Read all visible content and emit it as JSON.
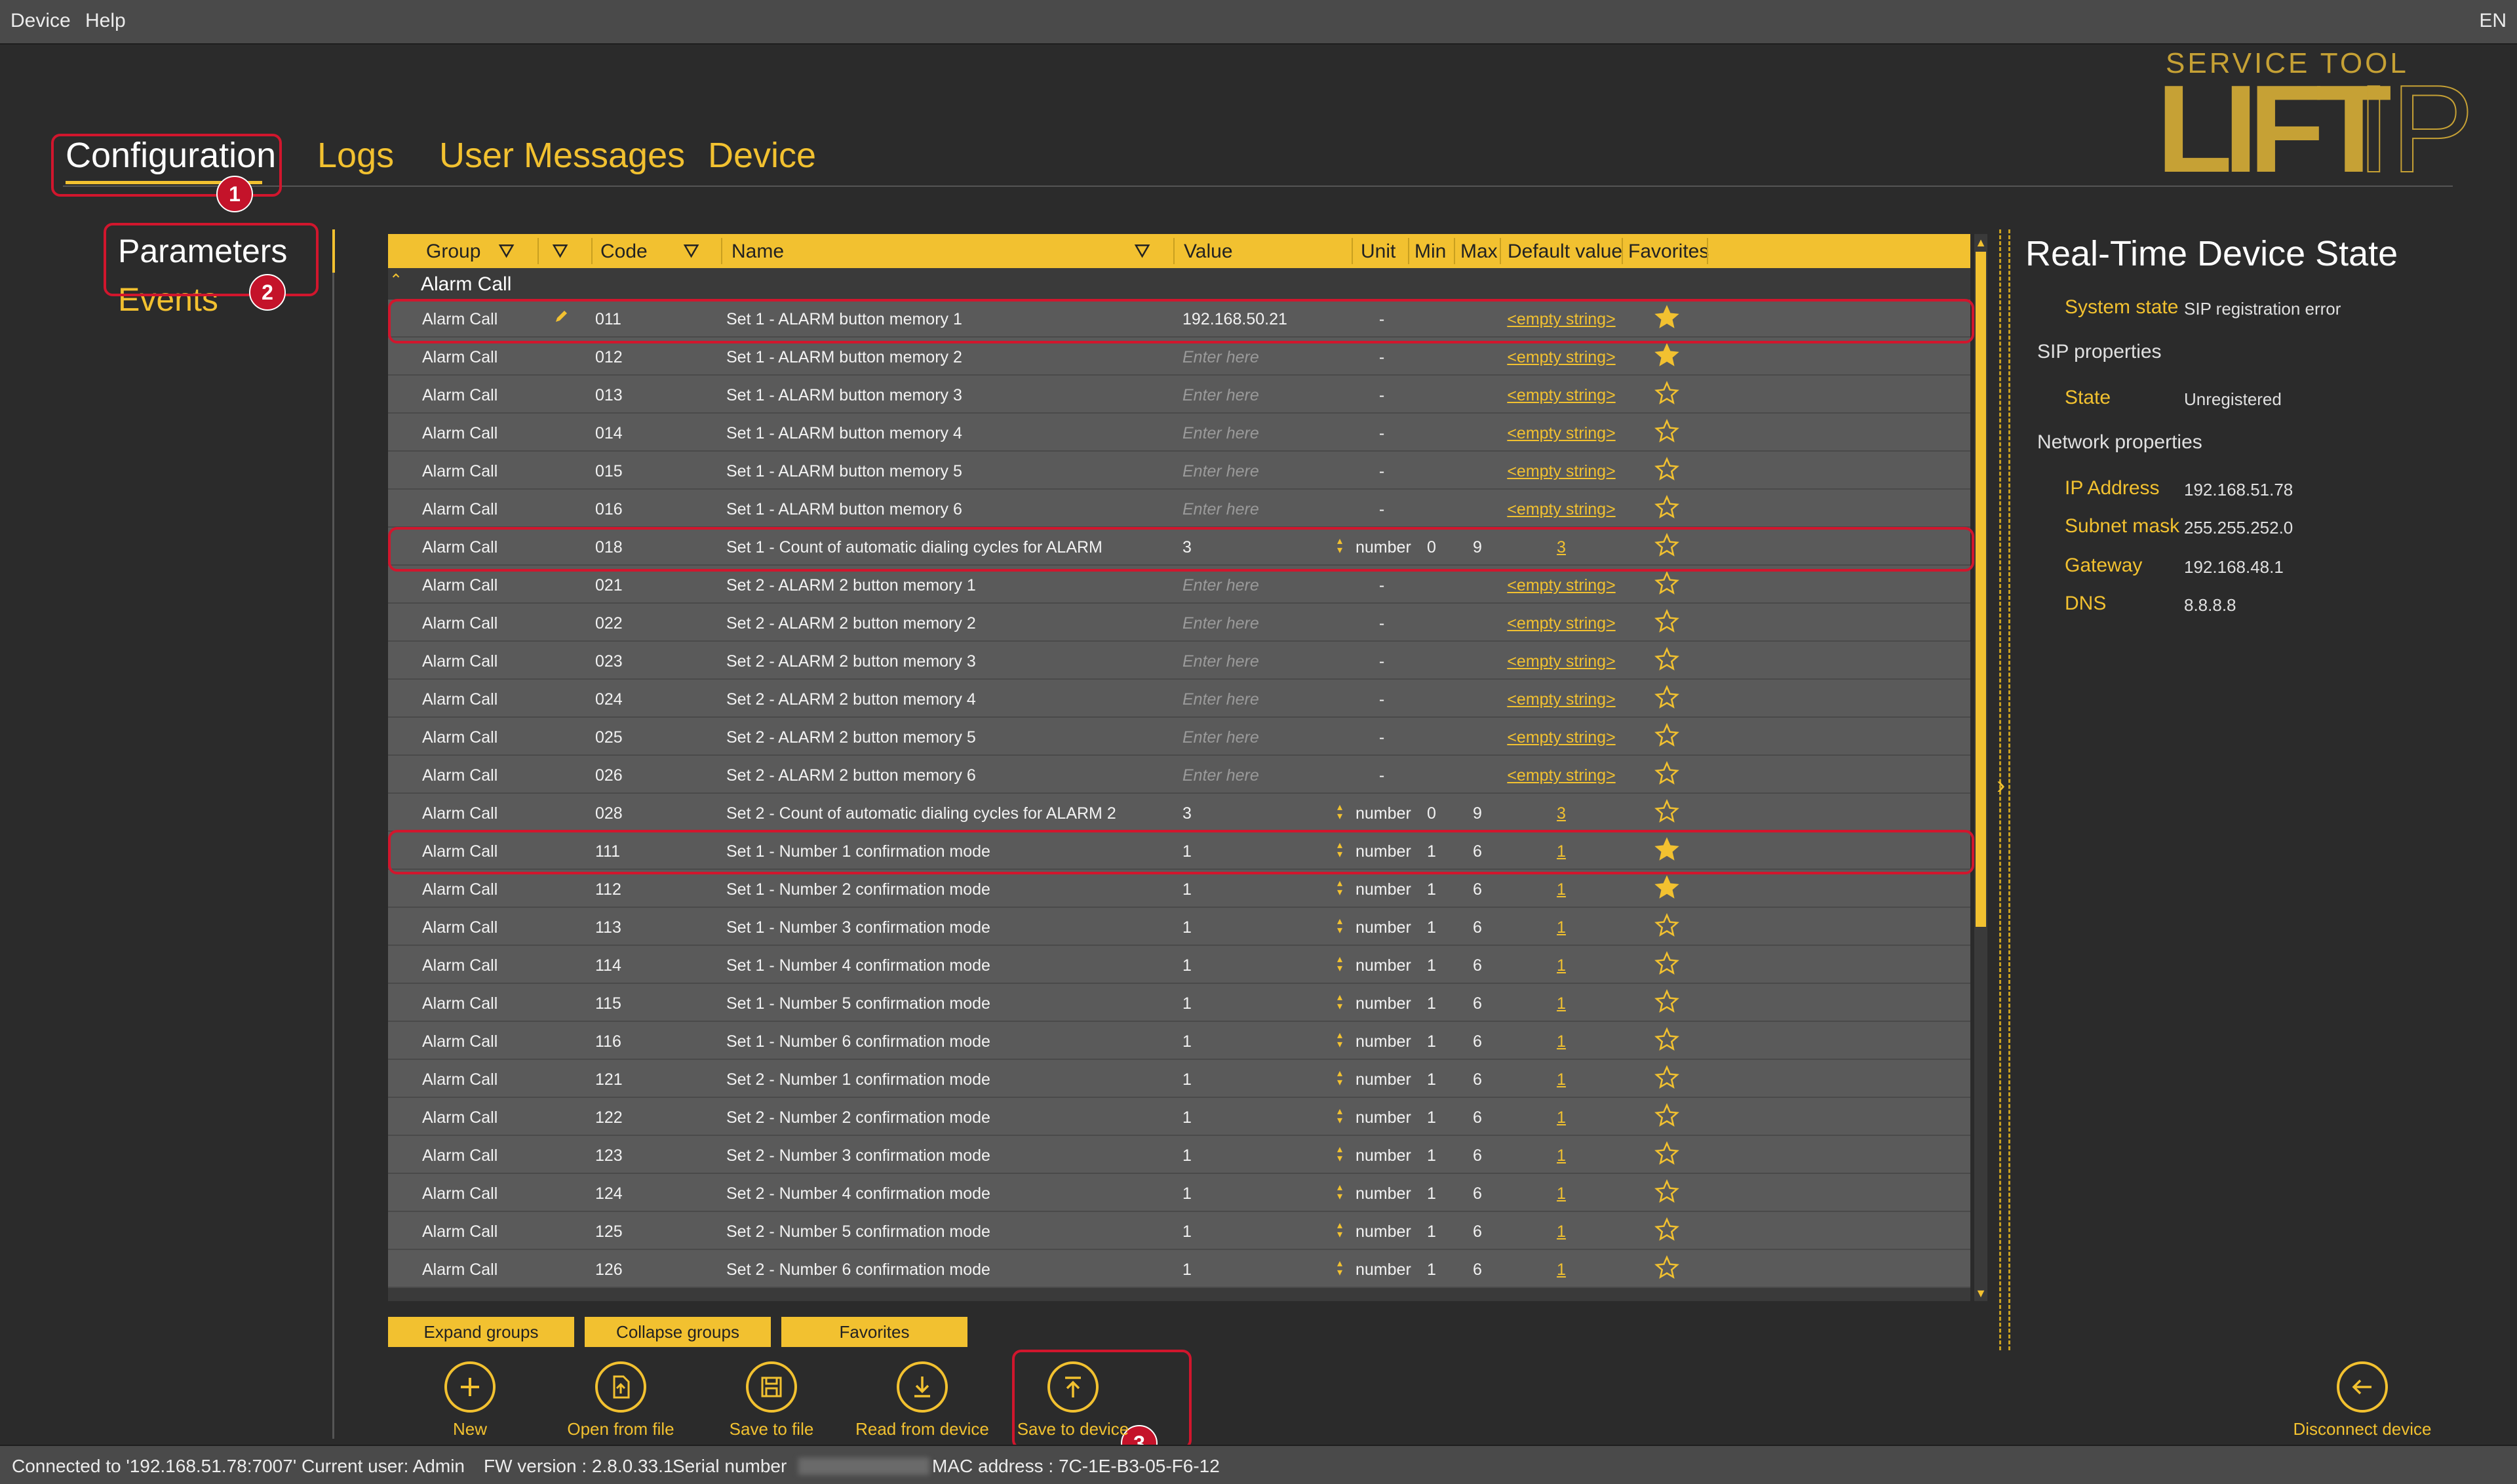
{
  "menu": {
    "device": "Device",
    "help": "Help",
    "lang": "EN"
  },
  "logo": {
    "top": "SERVICE TOOL",
    "main": "LIFT",
    "suffix": "IP"
  },
  "tabs": [
    "Configuration",
    "Logs",
    "User Messages",
    "Device"
  ],
  "left_nav": [
    "Parameters",
    "Events"
  ],
  "badges": [
    "1",
    "2",
    "3"
  ],
  "grid": {
    "headers": {
      "group": "Group",
      "code": "Code",
      "name": "Name",
      "value": "Value",
      "unit": "Unit",
      "min": "Min",
      "max": "Max",
      "default": "Default value",
      "favorites": "Favorites"
    },
    "group_title": "Alarm Call",
    "rows": [
      {
        "group": "Alarm Call",
        "edited": true,
        "code": "011",
        "name": "Set 1 - ALARM button memory 1",
        "value": "192.168.50.21",
        "placeholder": false,
        "spin": false,
        "unit": "-",
        "min": "",
        "max": "",
        "default": "<empty string>",
        "fav": true
      },
      {
        "group": "Alarm Call",
        "edited": false,
        "code": "012",
        "name": "Set 1 - ALARM button memory 2",
        "value": "Enter here",
        "placeholder": true,
        "spin": false,
        "unit": "-",
        "min": "",
        "max": "",
        "default": "<empty string>",
        "fav": true
      },
      {
        "group": "Alarm Call",
        "edited": false,
        "code": "013",
        "name": "Set 1 - ALARM button memory 3",
        "value": "Enter here",
        "placeholder": true,
        "spin": false,
        "unit": "-",
        "min": "",
        "max": "",
        "default": "<empty string>",
        "fav": false
      },
      {
        "group": "Alarm Call",
        "edited": false,
        "code": "014",
        "name": "Set 1 - ALARM button memory 4",
        "value": "Enter here",
        "placeholder": true,
        "spin": false,
        "unit": "-",
        "min": "",
        "max": "",
        "default": "<empty string>",
        "fav": false
      },
      {
        "group": "Alarm Call",
        "edited": false,
        "code": "015",
        "name": "Set 1 - ALARM button memory 5",
        "value": "Enter here",
        "placeholder": true,
        "spin": false,
        "unit": "-",
        "min": "",
        "max": "",
        "default": "<empty string>",
        "fav": false
      },
      {
        "group": "Alarm Call",
        "edited": false,
        "code": "016",
        "name": "Set 1 - ALARM button memory 6",
        "value": "Enter here",
        "placeholder": true,
        "spin": false,
        "unit": "-",
        "min": "",
        "max": "",
        "default": "<empty string>",
        "fav": false
      },
      {
        "group": "Alarm Call",
        "edited": false,
        "code": "018",
        "name": "Set 1 - Count of automatic dialing cycles for ALARM",
        "value": "3",
        "placeholder": false,
        "spin": true,
        "unit": "number",
        "min": "0",
        "max": "9",
        "default": "3",
        "fav": false
      },
      {
        "group": "Alarm Call",
        "edited": false,
        "code": "021",
        "name": "Set 2 - ALARM 2 button memory 1",
        "value": "Enter here",
        "placeholder": true,
        "spin": false,
        "unit": "-",
        "min": "",
        "max": "",
        "default": "<empty string>",
        "fav": false
      },
      {
        "group": "Alarm Call",
        "edited": false,
        "code": "022",
        "name": "Set 2 - ALARM 2 button memory 2",
        "value": "Enter here",
        "placeholder": true,
        "spin": false,
        "unit": "-",
        "min": "",
        "max": "",
        "default": "<empty string>",
        "fav": false
      },
      {
        "group": "Alarm Call",
        "edited": false,
        "code": "023",
        "name": "Set 2 - ALARM 2 button memory 3",
        "value": "Enter here",
        "placeholder": true,
        "spin": false,
        "unit": "-",
        "min": "",
        "max": "",
        "default": "<empty string>",
        "fav": false
      },
      {
        "group": "Alarm Call",
        "edited": false,
        "code": "024",
        "name": "Set 2 - ALARM 2 button memory 4",
        "value": "Enter here",
        "placeholder": true,
        "spin": false,
        "unit": "-",
        "min": "",
        "max": "",
        "default": "<empty string>",
        "fav": false
      },
      {
        "group": "Alarm Call",
        "edited": false,
        "code": "025",
        "name": "Set 2 - ALARM 2 button memory 5",
        "value": "Enter here",
        "placeholder": true,
        "spin": false,
        "unit": "-",
        "min": "",
        "max": "",
        "default": "<empty string>",
        "fav": false
      },
      {
        "group": "Alarm Call",
        "edited": false,
        "code": "026",
        "name": "Set 2 - ALARM 2 button memory 6",
        "value": "Enter here",
        "placeholder": true,
        "spin": false,
        "unit": "-",
        "min": "",
        "max": "",
        "default": "<empty string>",
        "fav": false
      },
      {
        "group": "Alarm Call",
        "edited": false,
        "code": "028",
        "name": "Set 2 - Count of automatic dialing cycles for ALARM 2",
        "value": "3",
        "placeholder": false,
        "spin": true,
        "unit": "number",
        "min": "0",
        "max": "9",
        "default": "3",
        "fav": false
      },
      {
        "group": "Alarm Call",
        "edited": false,
        "code": "111",
        "name": "Set 1 - Number 1 confirmation mode",
        "value": "1",
        "placeholder": false,
        "spin": true,
        "unit": "number",
        "min": "1",
        "max": "6",
        "default": "1",
        "fav": true
      },
      {
        "group": "Alarm Call",
        "edited": false,
        "code": "112",
        "name": "Set 1 - Number 2 confirmation mode",
        "value": "1",
        "placeholder": false,
        "spin": true,
        "unit": "number",
        "min": "1",
        "max": "6",
        "default": "1",
        "fav": true
      },
      {
        "group": "Alarm Call",
        "edited": false,
        "code": "113",
        "name": "Set 1 - Number 3 confirmation mode",
        "value": "1",
        "placeholder": false,
        "spin": true,
        "unit": "number",
        "min": "1",
        "max": "6",
        "default": "1",
        "fav": false
      },
      {
        "group": "Alarm Call",
        "edited": false,
        "code": "114",
        "name": "Set 1 - Number 4 confirmation mode",
        "value": "1",
        "placeholder": false,
        "spin": true,
        "unit": "number",
        "min": "1",
        "max": "6",
        "default": "1",
        "fav": false
      },
      {
        "group": "Alarm Call",
        "edited": false,
        "code": "115",
        "name": "Set 1 - Number 5 confirmation mode",
        "value": "1",
        "placeholder": false,
        "spin": true,
        "unit": "number",
        "min": "1",
        "max": "6",
        "default": "1",
        "fav": false
      },
      {
        "group": "Alarm Call",
        "edited": false,
        "code": "116",
        "name": "Set 1 - Number 6 confirmation mode",
        "value": "1",
        "placeholder": false,
        "spin": true,
        "unit": "number",
        "min": "1",
        "max": "6",
        "default": "1",
        "fav": false
      },
      {
        "group": "Alarm Call",
        "edited": false,
        "code": "121",
        "name": "Set 2 - Number 1 confirmation mode",
        "value": "1",
        "placeholder": false,
        "spin": true,
        "unit": "number",
        "min": "1",
        "max": "6",
        "default": "1",
        "fav": false
      },
      {
        "group": "Alarm Call",
        "edited": false,
        "code": "122",
        "name": "Set 2 - Number 2 confirmation mode",
        "value": "1",
        "placeholder": false,
        "spin": true,
        "unit": "number",
        "min": "1",
        "max": "6",
        "default": "1",
        "fav": false
      },
      {
        "group": "Alarm Call",
        "edited": false,
        "code": "123",
        "name": "Set 2 - Number 3 confirmation mode",
        "value": "1",
        "placeholder": false,
        "spin": true,
        "unit": "number",
        "min": "1",
        "max": "6",
        "default": "1",
        "fav": false
      },
      {
        "group": "Alarm Call",
        "edited": false,
        "code": "124",
        "name": "Set 2 - Number 4 confirmation mode",
        "value": "1",
        "placeholder": false,
        "spin": true,
        "unit": "number",
        "min": "1",
        "max": "6",
        "default": "1",
        "fav": false
      },
      {
        "group": "Alarm Call",
        "edited": false,
        "code": "125",
        "name": "Set 2 - Number 5 confirmation mode",
        "value": "1",
        "placeholder": false,
        "spin": true,
        "unit": "number",
        "min": "1",
        "max": "6",
        "default": "1",
        "fav": false
      },
      {
        "group": "Alarm Call",
        "edited": false,
        "code": "126",
        "name": "Set 2 - Number 6 confirmation mode",
        "value": "1",
        "placeholder": false,
        "spin": true,
        "unit": "number",
        "min": "1",
        "max": "6",
        "default": "1",
        "fav": false
      }
    ]
  },
  "bottom_tabs": {
    "expand": "Expand groups",
    "collapse": "Collapse groups",
    "favorites": "Favorites"
  },
  "actions": {
    "new": "New",
    "open": "Open from file",
    "save_file": "Save to file",
    "read": "Read from device",
    "save_device": "Save to device",
    "disconnect": "Disconnect device"
  },
  "realtime": {
    "title": "Real-Time Device State",
    "system_state_label": "System state",
    "system_state": "SIP registration error",
    "sip_section": "SIP properties",
    "state_label": "State",
    "state": "Unregistered",
    "network_section": "Network properties",
    "ip_label": "IP Address",
    "ip": "192.168.51.78",
    "mask_label": "Subnet mask",
    "mask": "255.255.252.0",
    "gateway_label": "Gateway",
    "gateway": "192.168.48.1",
    "dns_label": "DNS",
    "dns": "8.8.8.8"
  },
  "status": {
    "connected": "Connected to '192.168.51.78:7007'",
    "user": "Current user: Admin",
    "fw": "FW version : 2.8.0.33.1",
    "serial_label": "Serial number",
    "mac": "MAC address : 7C-1E-B3-05-F6-12"
  },
  "colors": {
    "accent": "#f2c130",
    "highlight": "#d1162d",
    "background": "#2b2b2b",
    "row": "#5a5a5a"
  }
}
